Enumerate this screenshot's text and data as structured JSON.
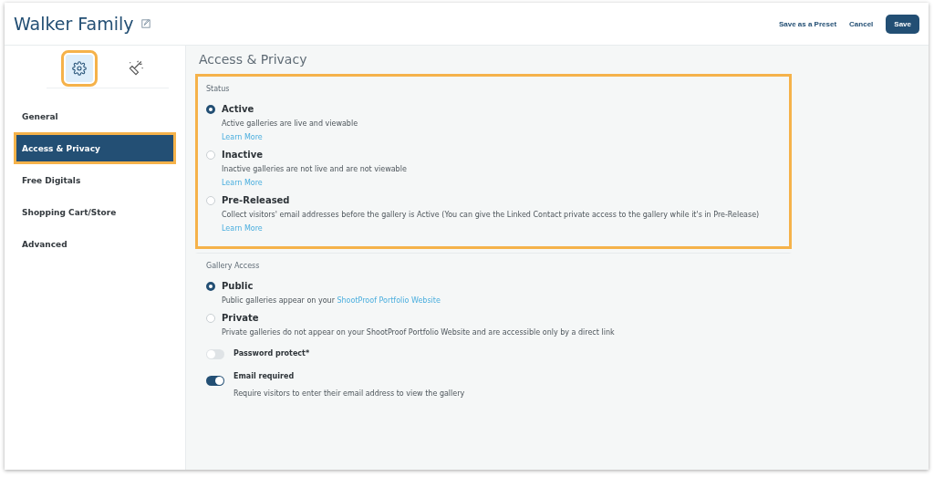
{
  "header": {
    "title": "Walker Family",
    "actions": [
      {
        "label": "Save as a Preset",
        "kind": "link"
      },
      {
        "label": "Cancel",
        "kind": "link"
      },
      {
        "label": "Save",
        "kind": "primary"
      }
    ]
  },
  "sidebar": {
    "tabs": [
      {
        "selected": true,
        "highlighted": true
      },
      {
        "selected": false,
        "highlighted": false
      }
    ],
    "nav": [
      {
        "label": "General",
        "selected": false,
        "highlighted": false
      },
      {
        "label": "Access & Privacy",
        "selected": true,
        "highlighted": true
      },
      {
        "label": "Free Digitals",
        "selected": false,
        "highlighted": false
      },
      {
        "label": "Shopping Cart/Store",
        "selected": false,
        "highlighted": false
      },
      {
        "label": "Advanced",
        "selected": false,
        "highlighted": false
      }
    ]
  },
  "content": {
    "title": "Access & Privacy",
    "sections": [
      {
        "heading": "Status",
        "highlighted": true,
        "options": [
          {
            "kind": "radio",
            "label": "Active",
            "selected": true,
            "description": "Active galleries are live and viewable",
            "link": "Learn More"
          },
          {
            "kind": "radio",
            "label": "Inactive",
            "selected": false,
            "description": "Inactive galleries are not live and are not viewable",
            "link": "Learn More"
          },
          {
            "kind": "radio",
            "label": "Pre-Released",
            "selected": false,
            "description": "Collect visitors' email addresses before the gallery is Active (You can give the Linked Contact private access to the gallery while it's in Pre-Release)",
            "link": "Learn More"
          }
        ]
      },
      {
        "heading": "Gallery Access",
        "highlighted": false,
        "options": [
          {
            "kind": "radio",
            "label": "Public",
            "selected": true,
            "description": "Public galleries appear on your",
            "inline_link": "ShootProof Portfolio Website"
          },
          {
            "kind": "radio",
            "label": "Private",
            "selected": false,
            "description": "Private galleries do not appear on your ShootProof Portfolio Website and are accessible only by a direct link"
          },
          {
            "kind": "toggle",
            "label": "Password protect*",
            "on": false
          },
          {
            "kind": "toggle",
            "label": "Email required",
            "on": true,
            "description": "Require visitors to enter their email address to view the gallery"
          }
        ]
      }
    ]
  }
}
